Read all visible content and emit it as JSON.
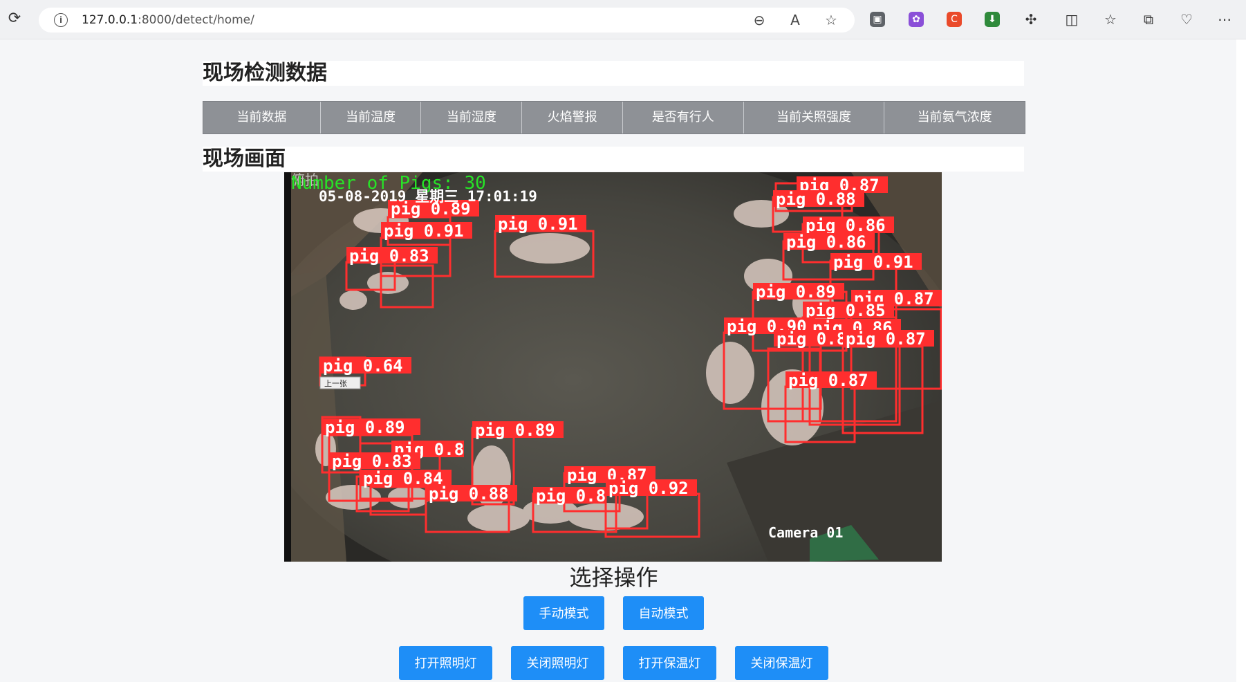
{
  "browser": {
    "url_host": "127.0.0.1",
    "url_rest": ":8000/detect/home/"
  },
  "sections": {
    "data_title": "现场检测数据",
    "video_title": "现场画面"
  },
  "data_columns": [
    "当前数据",
    "当前温度",
    "当前湿度",
    "火焰警报",
    "是否有行人",
    "当前关照强度",
    "当前氨气浓度"
  ],
  "camera": {
    "count_text": "Number of Pigs: 30",
    "datetime_text": "05-08-2019 星期三 17:01:19",
    "watermark": "俯拍",
    "camera_label": "Camera 01",
    "prev_button": "上一张",
    "detections": [
      {
        "label": "pig 0.87"
      },
      {
        "label": "pig 0.88"
      },
      {
        "label": "pig 0.86"
      },
      {
        "label": "pig 0.86"
      },
      {
        "label": "pig 0.91"
      },
      {
        "label": "pig 0.89"
      },
      {
        "label": "pig 0.87"
      },
      {
        "label": "pig 0.85"
      },
      {
        "label": "pig 0.90"
      },
      {
        "label": "pig 0.86"
      },
      {
        "label": "pig 0.8"
      },
      {
        "label": "pig 0.87"
      },
      {
        "label": "pig 0.87"
      },
      {
        "label": "pig 0.89"
      },
      {
        "label": "pig 0.91"
      },
      {
        "label": "pig 0.83"
      },
      {
        "label": "pig 0.91"
      },
      {
        "label": "pig 0.64"
      },
      {
        "label": "pig 0.89"
      },
      {
        "label": "pig 0.8"
      },
      {
        "label": "pig 0.83"
      },
      {
        "label": "pig 0.84"
      },
      {
        "label": "pig 0.89"
      },
      {
        "label": "pig 0.88"
      },
      {
        "label": "pig 0.87"
      },
      {
        "label": "pig 0.8"
      },
      {
        "label": "pig 0.92"
      }
    ]
  },
  "operations": {
    "title": "选择操作",
    "mode_buttons": [
      "手动模式",
      "自动模式"
    ],
    "light_buttons": [
      "打开照明灯",
      "关闭照明灯",
      "打开保温灯",
      "关闭保温灯"
    ]
  }
}
